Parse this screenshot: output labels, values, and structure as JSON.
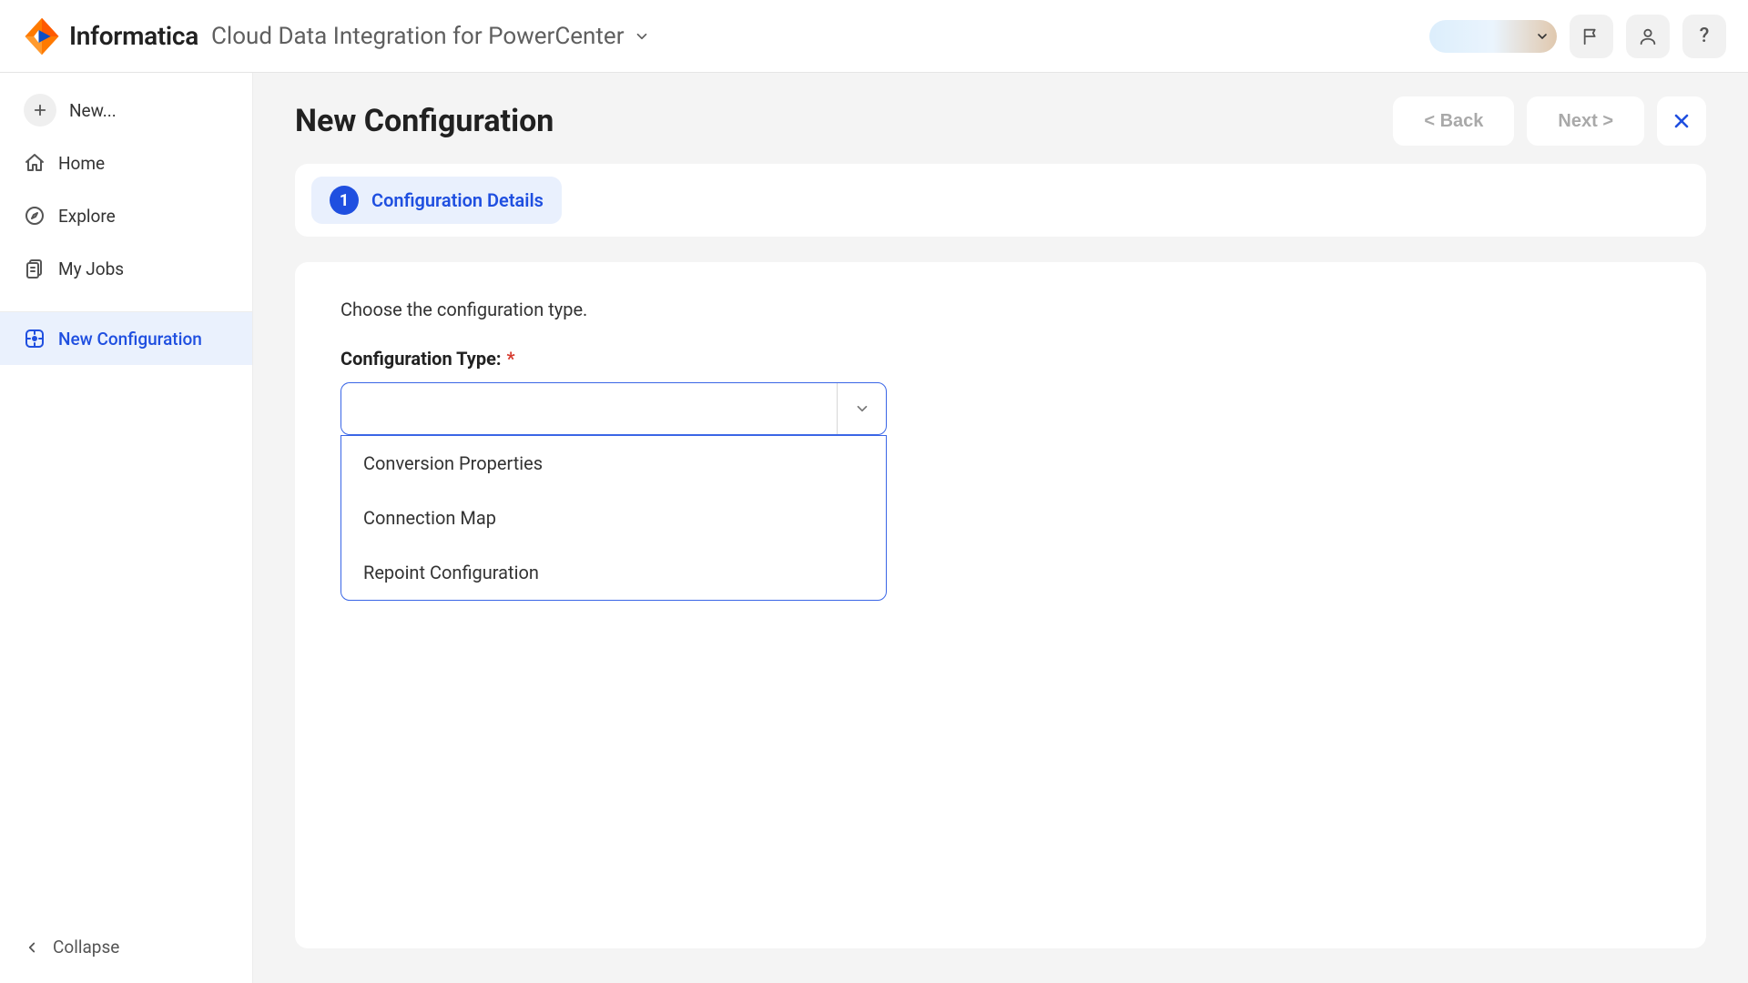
{
  "header": {
    "brand": "Informatica",
    "product": "Cloud Data Integration for PowerCenter"
  },
  "sidebar": {
    "items": [
      {
        "label": "New..."
      },
      {
        "label": "Home"
      },
      {
        "label": "Explore"
      },
      {
        "label": "My Jobs"
      },
      {
        "label": "New Configuration"
      }
    ],
    "collapse": "Collapse"
  },
  "page": {
    "title": "New Configuration",
    "back": "< Back",
    "next": "Next >"
  },
  "step": {
    "number": "1",
    "label": "Configuration Details"
  },
  "form": {
    "hint": "Choose the configuration type.",
    "config_type_label": "Configuration Type:",
    "options": [
      "Conversion Properties",
      "Connection Map",
      "Repoint Configuration"
    ]
  }
}
